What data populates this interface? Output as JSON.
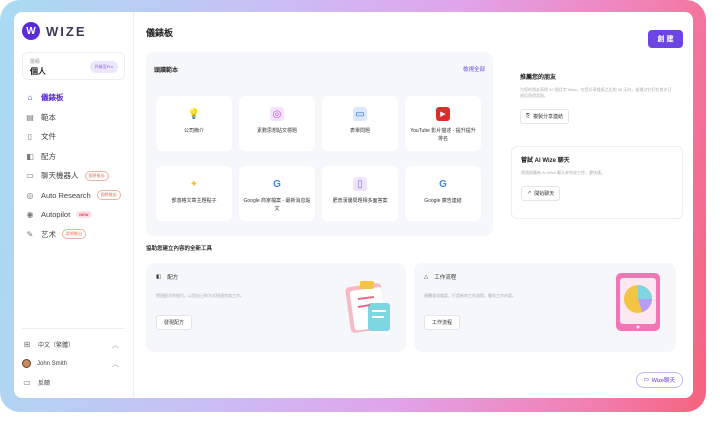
{
  "brand": {
    "logo_letter": "W",
    "name": "WIZE"
  },
  "plan": {
    "label": "層級",
    "name": "個人",
    "badge": "升級至Pro"
  },
  "sidebar": {
    "items": [
      {
        "label": "儀錶板",
        "icon": "home-icon",
        "active": true
      },
      {
        "label": "範本",
        "icon": "template-icon"
      },
      {
        "label": "文件",
        "icon": "document-icon"
      },
      {
        "label": "配方",
        "icon": "recipe-icon"
      },
      {
        "label": "聊天機器人",
        "icon": "chat-icon",
        "tag": "即將推出"
      },
      {
        "label": "Auto Research",
        "icon": "research-icon",
        "tag": "即將推出"
      },
      {
        "label": "Autopilot",
        "icon": "autopilot-icon",
        "tag_new": "NEW"
      },
      {
        "label": "艺术",
        "icon": "art-icon",
        "tag": "即將推出"
      }
    ],
    "bottom": {
      "language": "中文（繁體）",
      "user": "John Smith",
      "feedback": "反饋"
    }
  },
  "header": {
    "title": "儀錶板",
    "create_label": "創 建"
  },
  "templates": {
    "title": "頭讀範本",
    "see_all": "檢視全部",
    "cards": [
      {
        "label": "公司簡介",
        "icon": "bulb-icon",
        "glyph": "💡",
        "color": "#f2a03a"
      },
      {
        "label": "素數思想貼文標題",
        "icon": "camera-icon",
        "glyph": "◎",
        "color": "#c04ee0"
      },
      {
        "label": "表單問題",
        "icon": "form-icon",
        "glyph": "▭",
        "color": "#2a6ad8"
      },
      {
        "label": "YouTube 影片描述 - 提升提升排名",
        "icon": "youtube-icon",
        "glyph": "▶",
        "color": "#e02b2b"
      },
      {
        "label": "部落格文章主題點子",
        "icon": "idea-icon",
        "glyph": "✦",
        "color": "#f2c330"
      },
      {
        "label": "Google 商家檔案 - 最新消息貼文",
        "icon": "google-icon",
        "glyph": "G",
        "color": "#4285f4"
      },
      {
        "label": "肥普漢優問題相多面答案",
        "icon": "phone-icon",
        "glyph": "▯",
        "color": "#8b6ee8"
      },
      {
        "label": "Google 廣告連結",
        "icon": "google-icon",
        "glyph": "G",
        "color": "#4285f4"
      }
    ]
  },
  "invite": {
    "title": "推薦您的朋友",
    "description": "为您的朋友获得 20 個月字 Wize，在您分享链接之后的 30 天内，或通过它们在首次订阅后获得奖励。",
    "button": "複製分享連結"
  },
  "try_chat": {
    "title": "嘗試 AI Wize 聊天",
    "description": "透過與最新 AI Wize 聊天來完成工作，更快速。",
    "button": "開始聊天"
  },
  "tools": {
    "title": "協助您建立內容的全新工具",
    "recipe": {
      "label": "配方",
      "description": "透過配方的指引，以您自己的方式快速完成工作。",
      "button": "發現配方"
    },
    "workflow": {
      "label": "工作流程",
      "description": "連續發送檔案，打造新的工作流程，簡化工作內容。",
      "button": "工作流程"
    }
  },
  "chat_button": "Wize聊天"
}
